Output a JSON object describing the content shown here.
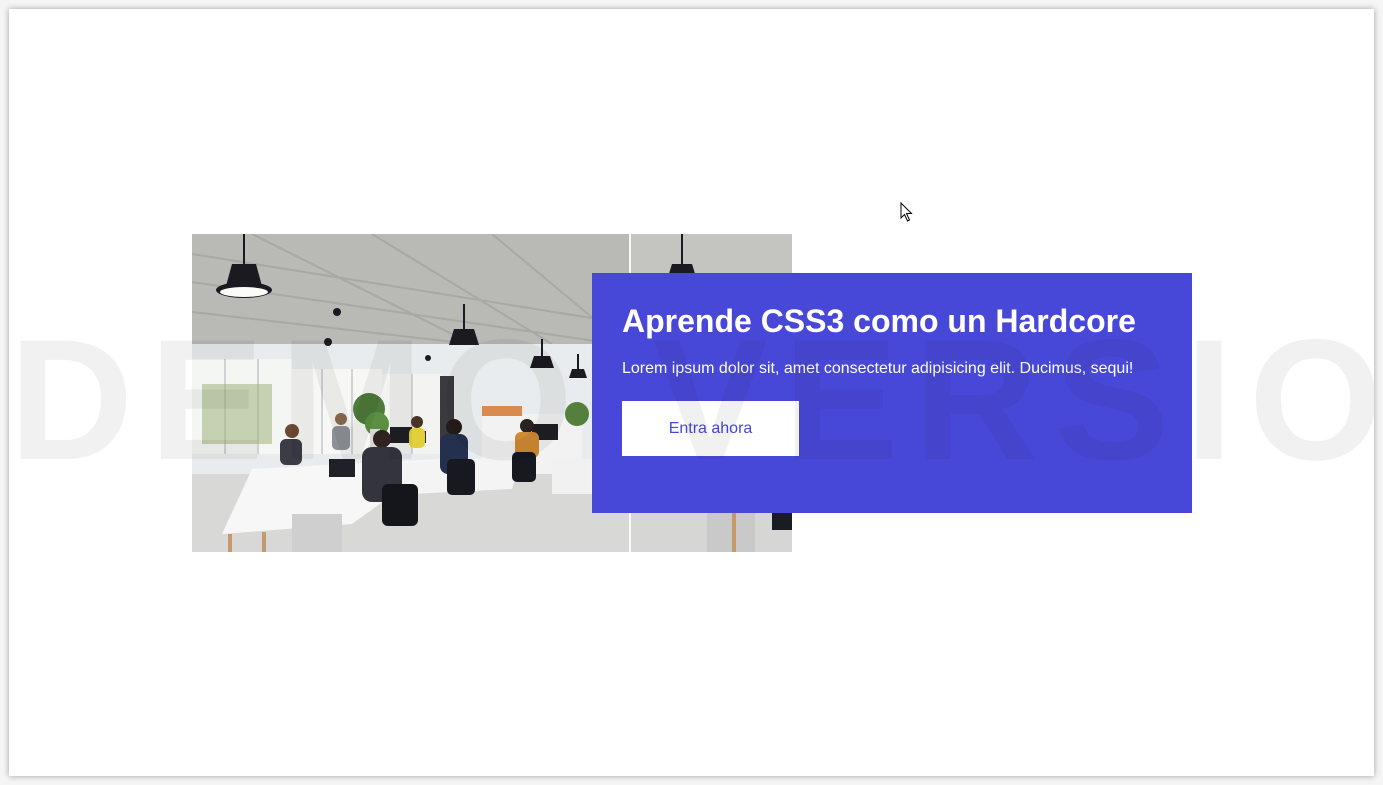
{
  "card": {
    "title": "Aprende CSS3 como un Hardcore",
    "text": "Lorem ipsum dolor sit, amet consectetur adipisicing elit. Ducimus, sequi!",
    "button_label": "Entra ahora"
  },
  "watermark": "DEMO VERSION",
  "colors": {
    "card_background": "#4848d8",
    "button_background": "#ffffff",
    "button_text": "#4848d8",
    "page_background": "#ffffff"
  },
  "icons": {
    "cursor": "arrow-cursor-icon"
  }
}
